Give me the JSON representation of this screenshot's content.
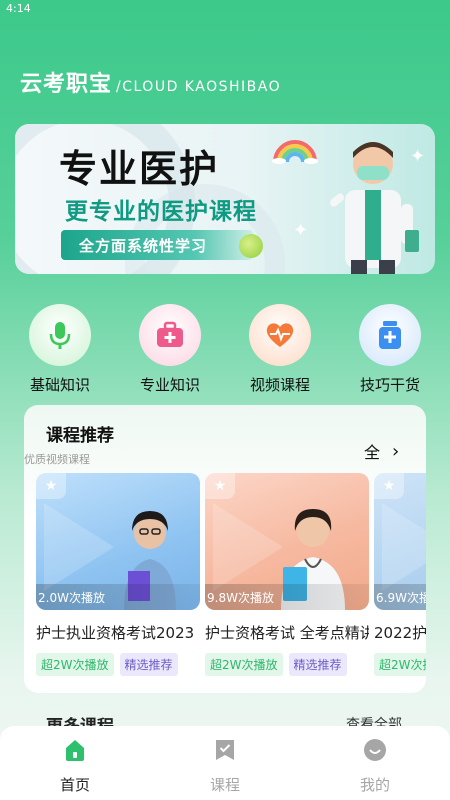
{
  "status": {
    "time": "4:14"
  },
  "app": {
    "title_cn": "云考职宝",
    "title_en": "/CLOUD KAOSHIBAO"
  },
  "banner": {
    "title": "专业医护",
    "subtitle": "更专业的医护课程",
    "pill": "全方面系统性学习"
  },
  "categories": [
    {
      "label": "基础知识",
      "icon": "microphone-icon",
      "color": "#3cc95a",
      "bg": "#d8f6dc"
    },
    {
      "label": "专业知识",
      "icon": "medical-kit-icon",
      "color": "#ef5a8c",
      "bg": "#fde0ea"
    },
    {
      "label": "视频课程",
      "icon": "heart-pulse-icon",
      "color": "#f57a3a",
      "bg": "#fde4d4"
    },
    {
      "label": "技巧干货",
      "icon": "medicine-bottle-icon",
      "color": "#3a8ff0",
      "bg": "#dcebfc"
    }
  ],
  "recommend": {
    "title": "课程推荐",
    "subtitle": "优质视频课程",
    "all_label": "全",
    "courses": [
      {
        "plays": "2.0W次播放",
        "title": "护士执业资格考试2023",
        "tag1": "超2W次播放",
        "tag2": "精选推荐"
      },
      {
        "plays": "9.8W次播放",
        "title": "护士资格考试 全考点精讲",
        "tag1": "超2W次播放",
        "tag2": "精选推荐"
      },
      {
        "plays": "6.9W次播",
        "title": "2022护",
        "tag1": "超2W次播",
        "tag2": ""
      }
    ]
  },
  "more": {
    "title": "更多课程",
    "link": "查看全部"
  },
  "tabs": [
    {
      "label": "首页",
      "icon": "home-icon",
      "active": true
    },
    {
      "label": "课程",
      "icon": "bookmark-icon",
      "active": false
    },
    {
      "label": "我的",
      "icon": "profile-icon",
      "active": false
    }
  ],
  "colors": {
    "accent": "#2fc06e",
    "tab_inactive": "#a6a6a6"
  }
}
